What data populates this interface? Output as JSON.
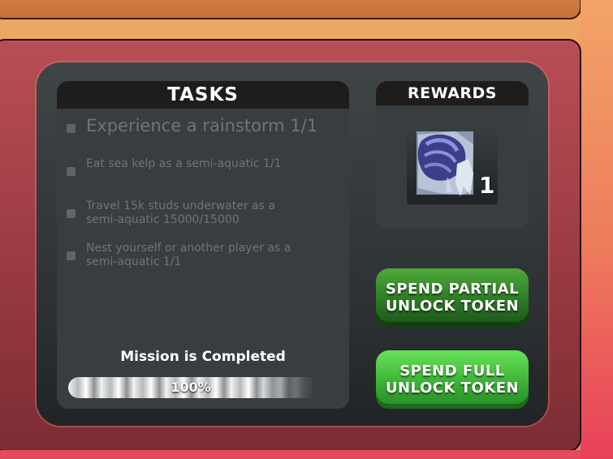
{
  "tasks": {
    "title": "TASKS",
    "items": [
      {
        "text": "Experience a rainstorm 1/1",
        "line2": ""
      },
      {
        "text": "Eat sea kelp as a semi-aquatic 1/1",
        "line2": ""
      },
      {
        "text": "Travel 15k studs underwater as a",
        "line2": "semi-aquatic 15000/15000"
      },
      {
        "text": "Nest yourself or another player as a",
        "line2": "semi-aquatic 1/1"
      }
    ],
    "status": "Mission is Completed",
    "progress_label": "100%",
    "progress": 1.0
  },
  "rewards": {
    "title": "REWARDS",
    "item_icon": "blue-creature-head-icon",
    "item_count": "1"
  },
  "buttons": {
    "partial": {
      "line1": "SPEND PARTIAL",
      "line2": "UNLOCK TOKEN"
    },
    "full": {
      "line1": "SPEND FULL",
      "line2": "UNLOCK TOKEN"
    }
  },
  "colors": {
    "partial_button": "#2c7a26",
    "full_button": "#3cb236",
    "panel": "#9a3a42",
    "task_text": "#6f7478"
  }
}
